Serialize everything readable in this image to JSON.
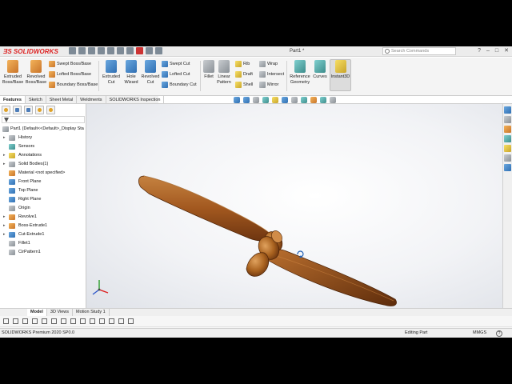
{
  "app": {
    "brand": "SOLIDWORKS",
    "document_title": "Part1 *",
    "search_placeholder": "Search Commands"
  },
  "window_controls": [
    "?",
    "–",
    "□",
    "✕"
  ],
  "ribbon": {
    "extruded_boss": "Extruded Boss/Base",
    "revolved_boss": "Revolved Boss/Base",
    "swept_boss": "Swept Boss/Base",
    "lofted_boss": "Lofted Boss/Base",
    "boundary_boss": "Boundary Boss/Base",
    "extruded_cut": "Extruded Cut",
    "hole_wizard": "Hole Wizard",
    "revolved_cut": "Revolved Cut",
    "swept_cut": "Swept Cut",
    "lofted_cut": "Lofted Cut",
    "boundary_cut": "Boundary Cut",
    "fillet": "Fillet",
    "linear_pattern": "Linear Pattern",
    "rib": "Rib",
    "draft": "Draft",
    "shell": "Shell",
    "wrap": "Wrap",
    "intersect": "Intersect",
    "mirror": "Mirror",
    "reference_geometry": "Reference Geometry",
    "curves": "Curves",
    "instant3d": "Instant3D"
  },
  "command_tabs": [
    "Features",
    "Sketch",
    "Sheet Metal",
    "Weldments",
    "SOLIDWORKS Inspection"
  ],
  "feature_tree": {
    "root": "Part1  (Default<<Default>_Display Sta",
    "items": [
      {
        "label": "History",
        "icon": "history-icon",
        "expandable": true
      },
      {
        "label": "Sensors",
        "icon": "sensor-icon",
        "expandable": false
      },
      {
        "label": "Annotations",
        "icon": "annotation-icon",
        "expandable": true
      },
      {
        "label": "Solid Bodies(1)",
        "icon": "solid-bodies-icon",
        "expandable": true
      },
      {
        "label": "Material <not specified>",
        "icon": "material-icon",
        "expandable": false
      },
      {
        "label": "Front Plane",
        "icon": "plane-icon",
        "expandable": false
      },
      {
        "label": "Top Plane",
        "icon": "plane-icon",
        "expandable": false
      },
      {
        "label": "Right Plane",
        "icon": "plane-icon",
        "expandable": false
      },
      {
        "label": "Origin",
        "icon": "origin-icon",
        "expandable": false
      },
      {
        "label": "Revolve1",
        "icon": "revolve-icon",
        "expandable": true
      },
      {
        "label": "Boss-Extrude1",
        "icon": "extrude-icon",
        "expandable": true
      },
      {
        "label": "Cut-Extrude1",
        "icon": "cut-icon",
        "expandable": true
      },
      {
        "label": "Fillet1",
        "icon": "fillet-icon",
        "expandable": false
      },
      {
        "label": "CirPattern1",
        "icon": "pattern-icon",
        "expandable": false
      }
    ]
  },
  "bottom_tabs": [
    "Model",
    "3D Views",
    "Motion Study 1"
  ],
  "status_bar": {
    "version": "SOLIDWORKS Premium 2020 SP0.0",
    "mode": "Editing Part",
    "units": "MMGS",
    "help": "?"
  },
  "colors": {
    "brand_red": "#d22222",
    "wood_light": "#b26a2c",
    "wood_dark": "#5a2c0c"
  }
}
